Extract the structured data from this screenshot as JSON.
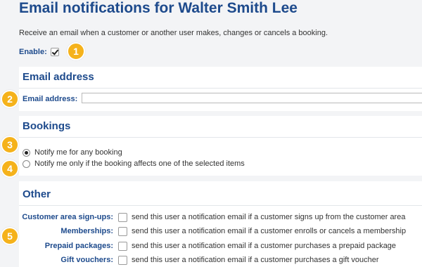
{
  "page": {
    "title": "Email notifications for Walter Smith Lee",
    "intro": "Receive an email when a customer or another user makes, changes or cancels a booking.",
    "enable_label": "Enable:",
    "enable_checked": true
  },
  "email_section": {
    "title": "Email address",
    "field_label": "Email address:",
    "field_value": ""
  },
  "bookings_section": {
    "title": "Bookings",
    "options": [
      {
        "label": "Notify me for any booking",
        "selected": true
      },
      {
        "label": "Notify me only if the booking affects one of the selected items",
        "selected": false
      }
    ]
  },
  "other_section": {
    "title": "Other",
    "rows": [
      {
        "label": "Customer area sign-ups:",
        "text": "send this user a notification email if a customer signs up from the customer area",
        "checked": false
      },
      {
        "label": "Memberships:",
        "text": "send this user a notification email if a customer enrolls or cancels a membership",
        "checked": false
      },
      {
        "label": "Prepaid packages:",
        "text": "send this user a notification email if a customer purchases a prepaid package",
        "checked": false
      },
      {
        "label": "Gift vouchers:",
        "text": "send this user a notification email if a customer purchases a gift voucher",
        "checked": false
      }
    ]
  },
  "badges": [
    "1",
    "2",
    "3",
    "4",
    "5"
  ],
  "colors": {
    "heading": "#1d4a8c",
    "badge": "#f5b21b",
    "background": "#f3f4f6"
  }
}
